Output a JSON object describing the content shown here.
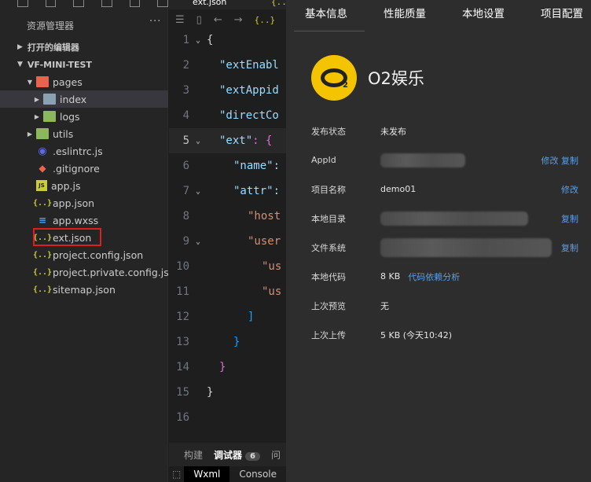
{
  "explorer": {
    "title": "资源管理器",
    "more": "···",
    "open_editors": "打开的编辑器",
    "project": "VF-MINI-TEST",
    "items": [
      {
        "label": "pages"
      },
      {
        "label": "index"
      },
      {
        "label": "logs"
      },
      {
        "label": "utils"
      },
      {
        "label": ".eslintrc.js"
      },
      {
        "label": ".gitignore"
      },
      {
        "label": "app.js"
      },
      {
        "label": "app.json"
      },
      {
        "label": "app.wxss"
      },
      {
        "label": "ext.json"
      },
      {
        "label": "project.config.json"
      },
      {
        "label": "project.private.config.js..."
      },
      {
        "label": "sitemap.json"
      }
    ]
  },
  "editor": {
    "tab_name": "ext.json",
    "tab_icon": "{..}",
    "crumb_icon": "{..}",
    "lines": [
      {
        "n": "1",
        "code": "{"
      },
      {
        "n": "2",
        "code": "\"extEnabl"
      },
      {
        "n": "3",
        "code": "\"extAppid"
      },
      {
        "n": "4",
        "code": "\"directCo"
      },
      {
        "n": "5",
        "key": "\"ext\"",
        "rest": ": {"
      },
      {
        "n": "6",
        "code": "\"name\":"
      },
      {
        "n": "7",
        "code": "\"attr\":"
      },
      {
        "n": "8",
        "code": "\"host"
      },
      {
        "n": "9",
        "code": "\"user"
      },
      {
        "n": "10",
        "code": "\"us"
      },
      {
        "n": "11",
        "code": "\"us"
      },
      {
        "n": "12",
        "code": "]"
      },
      {
        "n": "13",
        "code": "}"
      },
      {
        "n": "14",
        "code": "}"
      },
      {
        "n": "15",
        "code": "}"
      },
      {
        "n": "16",
        "code": ""
      }
    ],
    "bottom_tabs": {
      "build": "构建",
      "debugger": "调试器",
      "badge": "6",
      "more": "问"
    },
    "dev_tabs": {
      "wxml": "Wxml",
      "console": "Console"
    }
  },
  "panel": {
    "tabs": [
      "基本信息",
      "性能质量",
      "本地设置",
      "项目配置"
    ],
    "app_name": "O2娱乐",
    "logo_sub": "2",
    "rows": {
      "publish_status": {
        "label": "发布状态",
        "value": "未发布"
      },
      "appid": {
        "label": "AppId",
        "edit": "修改",
        "copy": "复制"
      },
      "project_name": {
        "label": "项目名称",
        "value": "demo01",
        "edit": "修改"
      },
      "local_dir": {
        "label": "本地目录",
        "copy": "复制"
      },
      "file_system": {
        "label": "文件系统",
        "copy": "复制"
      },
      "local_code": {
        "label": "本地代码",
        "value": "8 KB",
        "link": "代码依赖分析"
      },
      "last_preview": {
        "label": "上次预览",
        "value": "无"
      },
      "last_upload": {
        "label": "上次上传",
        "value": "5 KB  (今天10:42)"
      }
    }
  }
}
